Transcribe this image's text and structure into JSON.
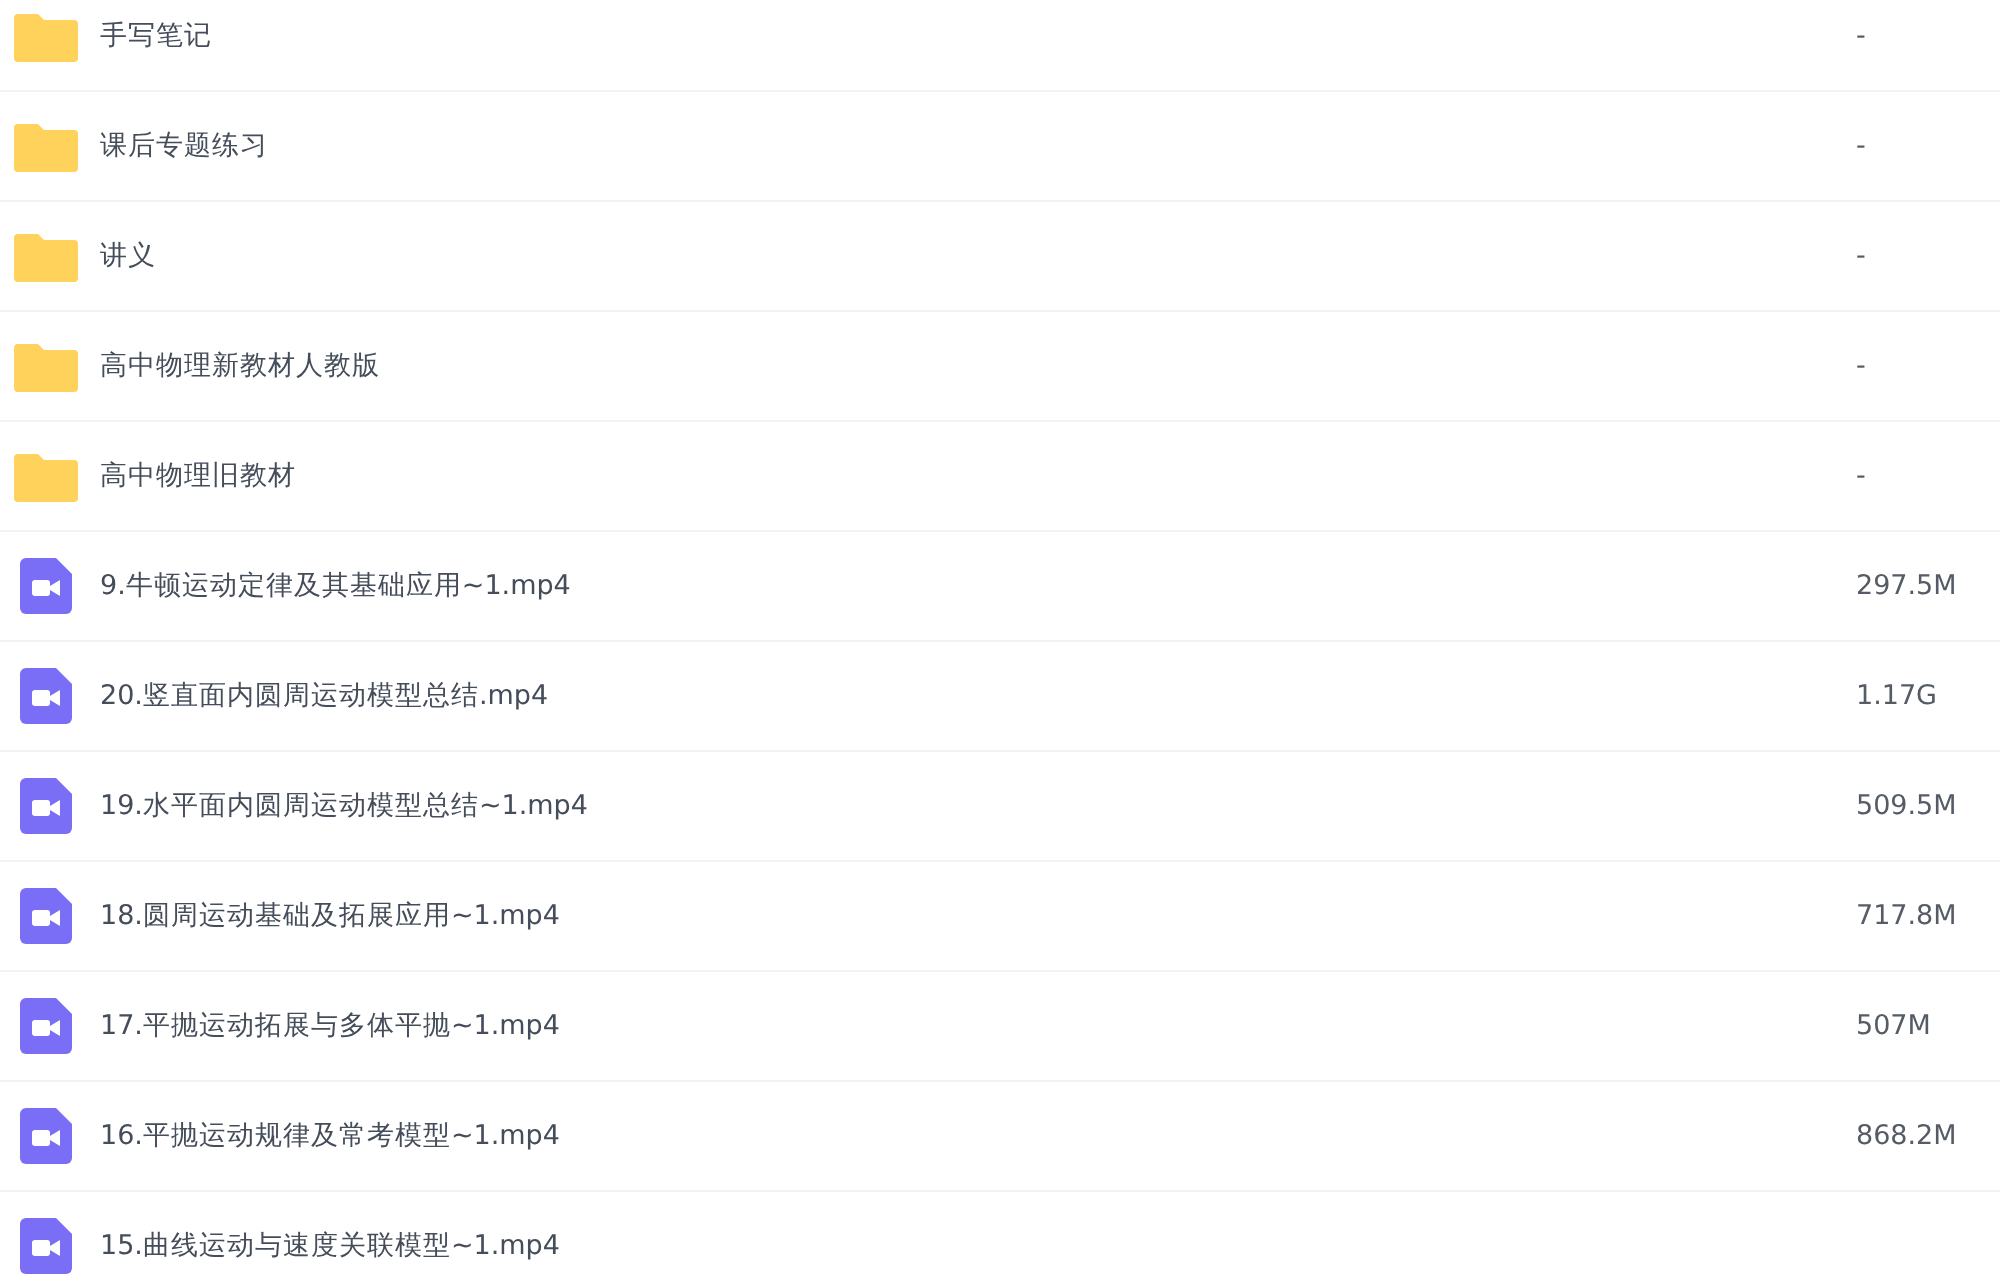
{
  "files": [
    {
      "kind": "folder",
      "name": "手写笔记",
      "size": "-"
    },
    {
      "kind": "folder",
      "name": "课后专题练习",
      "size": "-"
    },
    {
      "kind": "folder",
      "name": "讲义",
      "size": "-"
    },
    {
      "kind": "folder",
      "name": "高中物理新教材人教版",
      "size": "-"
    },
    {
      "kind": "folder",
      "name": "高中物理旧教材",
      "size": "-"
    },
    {
      "kind": "video",
      "name": "9.牛顿运动定律及其基础应用~1.mp4",
      "size": "297.5M"
    },
    {
      "kind": "video",
      "name": "20.竖直面内圆周运动模型总结.mp4",
      "size": "1.17G"
    },
    {
      "kind": "video",
      "name": "19.水平面内圆周运动模型总结~1.mp4",
      "size": "509.5M"
    },
    {
      "kind": "video",
      "name": "18.圆周运动基础及拓展应用~1.mp4",
      "size": "717.8M"
    },
    {
      "kind": "video",
      "name": "17.平抛运动拓展与多体平抛~1.mp4",
      "size": "507M"
    },
    {
      "kind": "video",
      "name": "16.平抛运动规律及常考模型~1.mp4",
      "size": "868.2M"
    },
    {
      "kind": "video",
      "name": "15.曲线运动与速度关联模型~1.mp4"
    }
  ]
}
